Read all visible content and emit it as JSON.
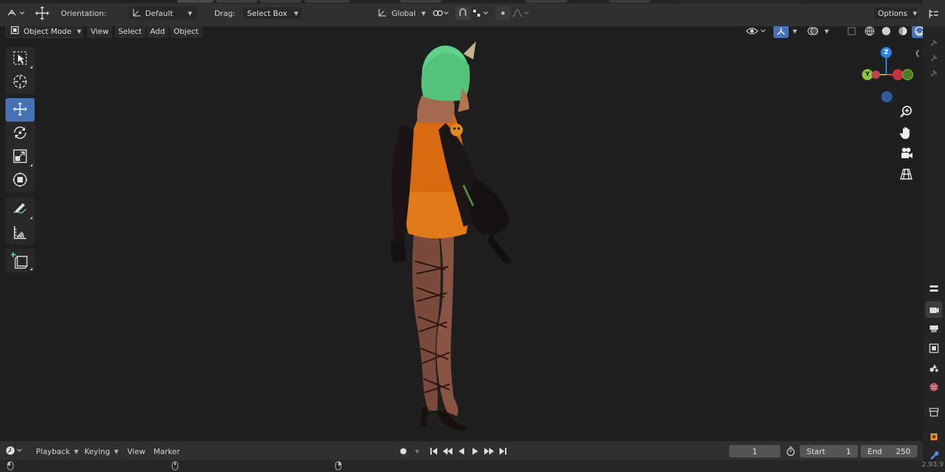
{
  "header": {
    "orientation_label": "Orientation:",
    "orientation_value": "Default",
    "drag_label": "Drag:",
    "drag_value": "Select Box",
    "transform_space": "Global",
    "options_label": "Options"
  },
  "viewport_header": {
    "mode": "Object Mode",
    "menus": [
      "View",
      "Select",
      "Add",
      "Object"
    ]
  },
  "gizmo": {
    "z_label": "Z",
    "y_label": "Y",
    "colors": {
      "x": "#e5414f",
      "y": "#8cc63f",
      "z": "#2a82e4"
    }
  },
  "timeline": {
    "menus": [
      "Playback",
      "Keying",
      "View",
      "Marker"
    ],
    "current_frame": "1",
    "start_label": "Start",
    "start_value": "1",
    "end_label": "End",
    "end_value": "250"
  },
  "status": {
    "version": "2.93.9"
  },
  "colors": {
    "accent": "#4772b3",
    "hair": "#5fd18a",
    "dress": "#d86a12"
  }
}
